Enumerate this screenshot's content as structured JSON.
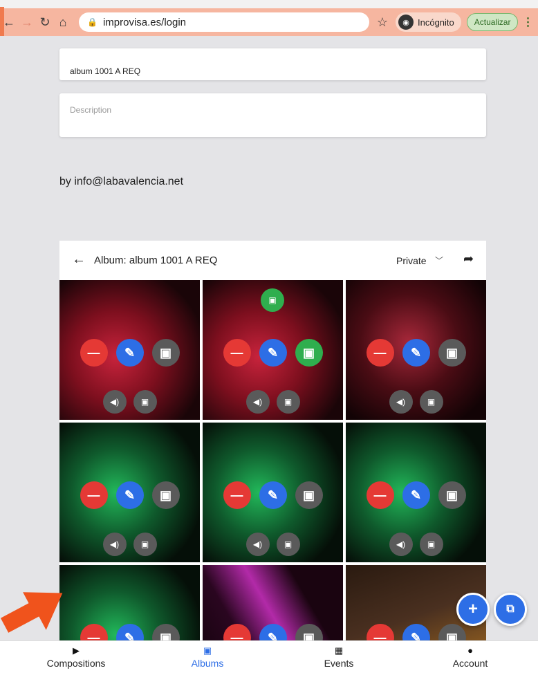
{
  "browser": {
    "url": "improvisa.es/login",
    "incognito_label": "Incógnito",
    "update_label": "Actualizar"
  },
  "form": {
    "title_value": "album 1001 A REQ",
    "description_placeholder": "Description",
    "by_line": "by info@labavalencia.net"
  },
  "album": {
    "title": "Album: album 1001 A REQ",
    "privacy": "Private"
  },
  "tiles": [
    {
      "image": "red-blurred",
      "image_button_color": "#5a5a5a",
      "cover_badge": false
    },
    {
      "image": "red-blurred",
      "image_button_color": "#2fae4e",
      "cover_badge": true
    },
    {
      "image": "red-x-blurred",
      "image_button_color": "#5a5a5a",
      "cover_badge": false
    },
    {
      "image": "green-blurred",
      "image_button_color": "#5a5a5a",
      "cover_badge": false
    },
    {
      "image": "green-blurred",
      "image_button_color": "#5a5a5a",
      "cover_badge": false
    },
    {
      "image": "green-blurred",
      "image_button_color": "#5a5a5a",
      "cover_badge": false
    },
    {
      "image": "green-blurred",
      "image_button_color": "#5a5a5a",
      "cover_badge": false
    },
    {
      "image": "magenta-blurred",
      "image_button_color": "#5a5a5a",
      "cover_badge": false
    },
    {
      "image": "arrow-blurred",
      "image_button_color": "#5a5a5a",
      "cover_badge": false
    }
  ],
  "bottom_nav": [
    {
      "label": "Compositions",
      "icon": "play-icon",
      "active": false
    },
    {
      "label": "Albums",
      "icon": "albums-icon",
      "active": true
    },
    {
      "label": "Events",
      "icon": "calendar-icon",
      "active": false
    },
    {
      "label": "Account",
      "icon": "account-icon",
      "active": false
    }
  ],
  "colors": {
    "accent": "#2d6ee6",
    "remove": "#e53935",
    "cover": "#2fae4e",
    "pointer_arrow": "#f0531c"
  }
}
